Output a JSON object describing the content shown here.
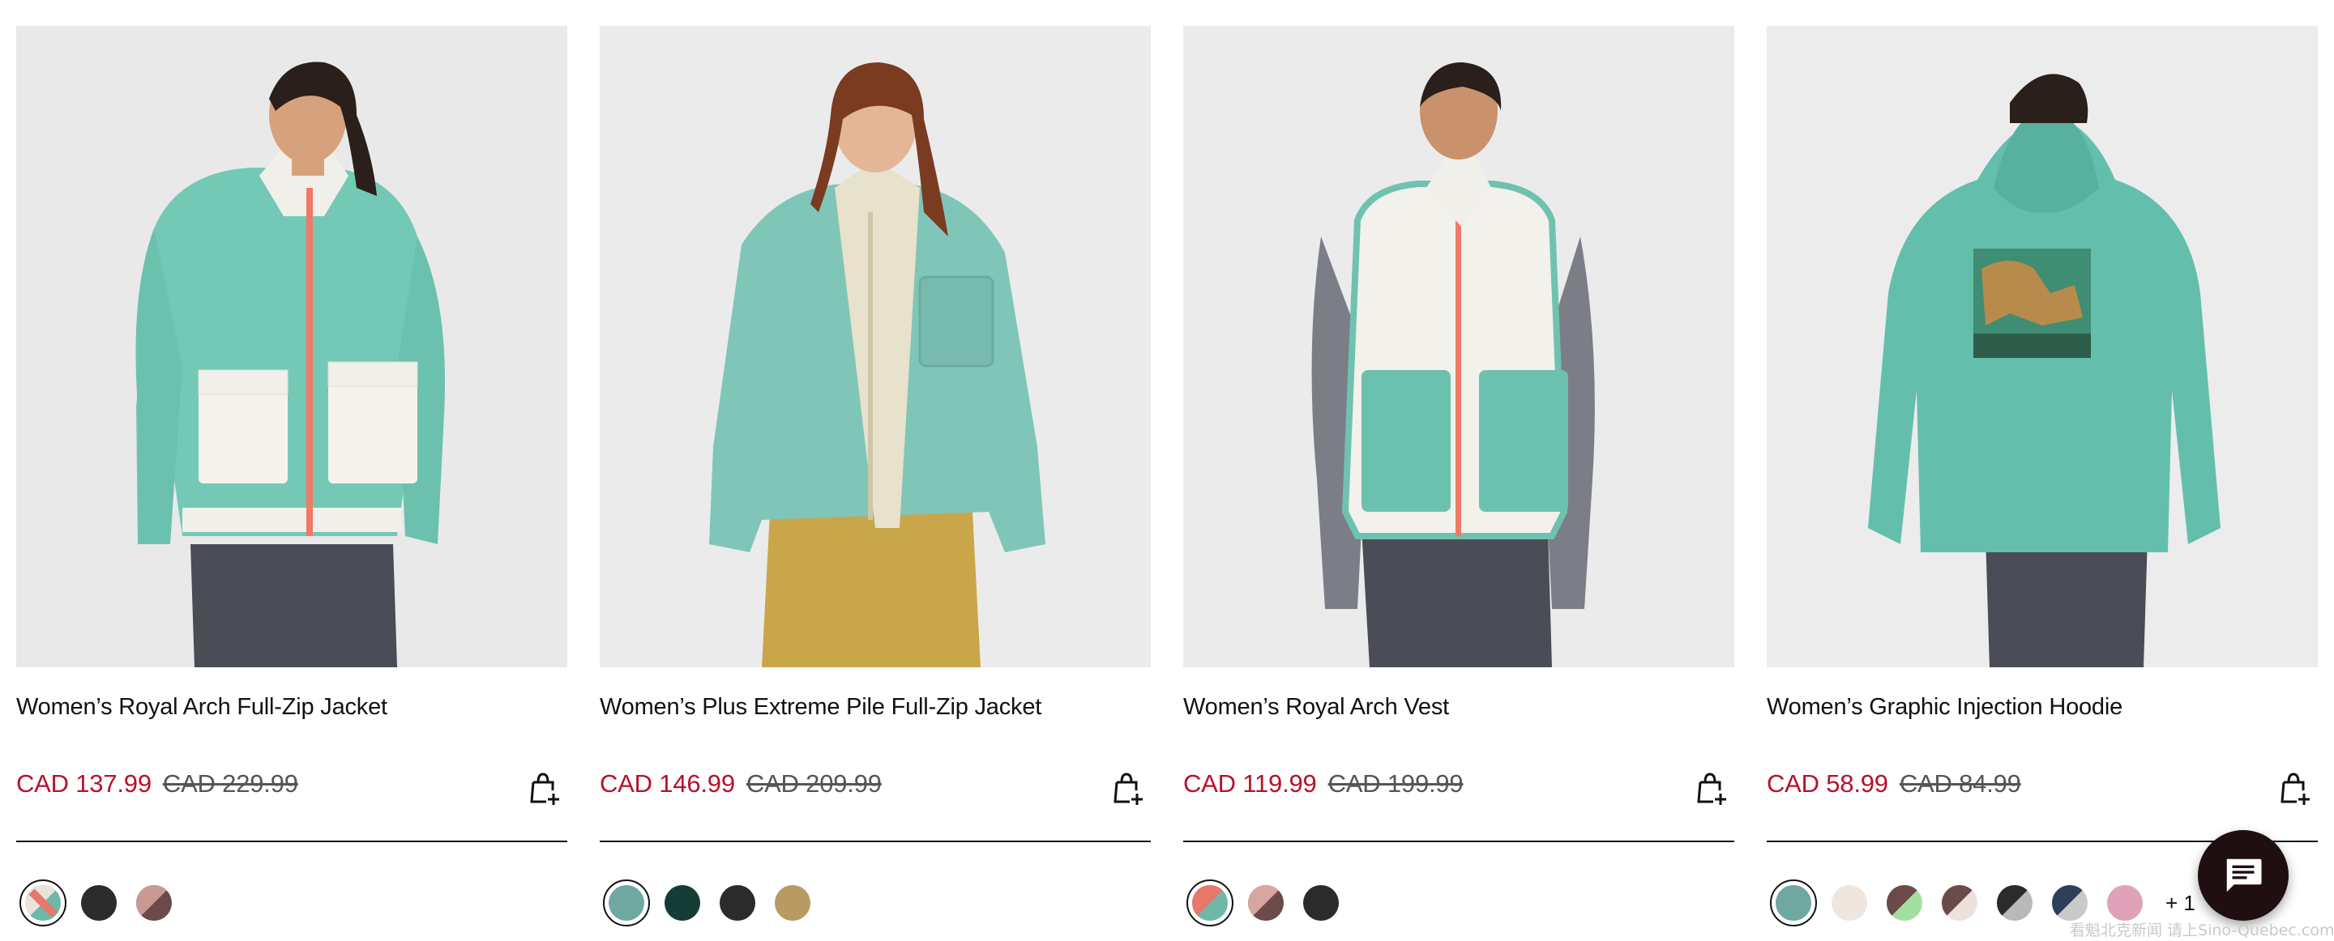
{
  "products": [
    {
      "title": "Women’s Royal Arch Full-Zip Jacket",
      "price_sale": "CAD 137.99",
      "price_original": "CAD 229.99",
      "image_alt": "Model wearing teal fleece jacket with white pockets and coral zipper",
      "swatches": [
        {
          "colors": [
            "#e9e3dc",
            "#e8786a",
            "#6fb7a9"
          ],
          "selected": true
        },
        {
          "colors": [
            "#2b2b2b"
          ],
          "selected": false
        },
        {
          "colors": [
            "#c99a93",
            "#6c4a4a"
          ],
          "selected": false
        }
      ]
    },
    {
      "title": "Women’s Plus Extreme Pile Full-Zip Jacket",
      "price_sale": "CAD 146.99",
      "price_original": "CAD 209.99",
      "image_alt": "Model wearing teal sherpa pile jacket with cream trim",
      "swatches": [
        {
          "colors": [
            "#6fa8a0"
          ],
          "selected": true
        },
        {
          "colors": [
            "#163d35"
          ],
          "selected": false
        },
        {
          "colors": [
            "#2b2b2b"
          ],
          "selected": false
        },
        {
          "colors": [
            "#b89a63"
          ],
          "selected": false
        }
      ]
    },
    {
      "title": "Women’s Royal Arch Vest",
      "price_sale": "CAD 119.99",
      "price_original": "CAD 199.99",
      "image_alt": "Model wearing white fleece vest with teal pockets",
      "swatches": [
        {
          "colors": [
            "#e8786a",
            "#6fb7a9"
          ],
          "selected": true
        },
        {
          "colors": [
            "#d8a6a0",
            "#6c4a4a"
          ],
          "selected": false
        },
        {
          "colors": [
            "#2b2b2b"
          ],
          "selected": false
        }
      ]
    },
    {
      "title": "Women’s Graphic Injection Hoodie",
      "price_sale": "CAD 58.99",
      "price_original": "CAD 84.99",
      "image_alt": "Back view of model wearing teal hoodie with graphic print",
      "more_colors": "+ 1",
      "swatches": [
        {
          "colors": [
            "#6fa8a0"
          ],
          "selected": true
        },
        {
          "colors": [
            "#eee6df"
          ],
          "selected": false
        },
        {
          "colors": [
            "#a3e0a0",
            "#6c4a4a"
          ],
          "selected": false
        },
        {
          "colors": [
            "#eee1dc",
            "#6c4a4a"
          ],
          "selected": false
        },
        {
          "colors": [
            "#b9b9b9",
            "#2b2b2b"
          ],
          "selected": false
        },
        {
          "colors": [
            "#c9c9c9",
            "#2c3e5c"
          ],
          "selected": false
        },
        {
          "colors": [
            "#dfa2b8"
          ],
          "selected": false
        }
      ]
    }
  ],
  "icons": {
    "cart": "add-to-cart-icon",
    "chat": "chat-bubble-icon"
  },
  "colors": {
    "sale_price": "#b8112a",
    "original_price": "#555555",
    "chat_button": "#1f0f10"
  },
  "watermark": "看魁北克新闻 请上Sino-Quebec.com"
}
